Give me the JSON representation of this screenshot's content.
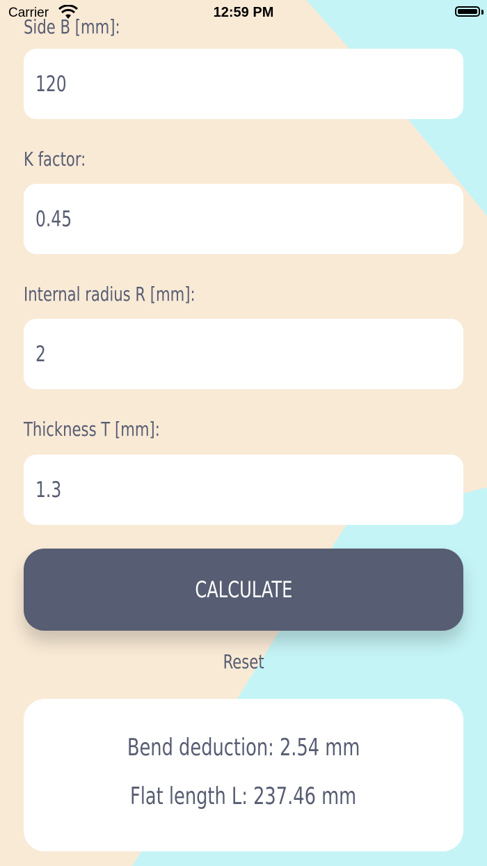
{
  "status_bar": {
    "carrier": "Carrier",
    "time": "12:59 PM",
    "wifi_icon": "wifi-icon",
    "battery_icon": "battery-icon"
  },
  "colors": {
    "background_peach": "#f9ead6",
    "background_cyan": "#c5f4f6",
    "text": "#575d72",
    "button": "#575d72",
    "field": "#ffffff"
  },
  "form": {
    "side_b": {
      "label": "Side B [mm]:",
      "value": "120"
    },
    "k_factor": {
      "label": "K factor:",
      "value": "0.45"
    },
    "radius": {
      "label": "Internal radius R [mm]:",
      "value": "2"
    },
    "thickness": {
      "label": "Thickness T [mm]:",
      "value": "1.3"
    }
  },
  "actions": {
    "calculate_label": "CALCULATE",
    "reset_label": "Reset"
  },
  "results": {
    "bend_deduction": "Bend deduction: 2.54 mm",
    "flat_length": "Flat length L: 237.46 mm"
  }
}
